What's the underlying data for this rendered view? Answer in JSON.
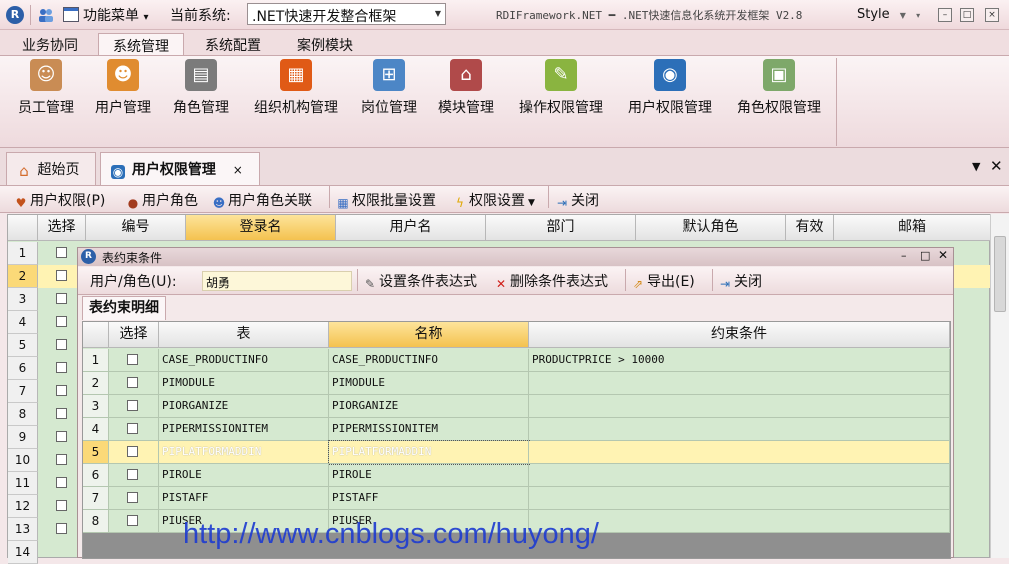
{
  "titlebar": {
    "menu_label": "功能菜单",
    "menu_caret": "▾",
    "system_label": "当前系统:",
    "system_value": ".NET快速开发整合框架",
    "app_title": "RDIFramework.NET ━ .NET快速信息化系统开发框架 V2.8",
    "style_label": "Style"
  },
  "ribbon_tabs": [
    "业务协同",
    "系统管理",
    "系统配置",
    "案例模块"
  ],
  "ribbon_buttons": [
    "员工管理",
    "用户管理",
    "角色管理",
    "组织机构管理",
    "岗位管理",
    "模块管理",
    "操作权限管理",
    "用户权限管理",
    "角色权限管理"
  ],
  "doc_tabs": {
    "home": "超始页",
    "current": "用户权限管理",
    "close": "×"
  },
  "toolbar": {
    "user_perm": "用户权限(P)",
    "user_role": "用户角色",
    "user_role_link": "用户角色关联",
    "batch_perm": "权限批量设置",
    "perm_setting": "权限设置",
    "close": "关闭"
  },
  "grid": {
    "headers": [
      "选择",
      "编号",
      "登录名",
      "用户名",
      "部门",
      "默认角色",
      "有效",
      "邮箱"
    ],
    "row_numbers": [
      "1",
      "2",
      "3",
      "4",
      "5",
      "6",
      "7",
      "8",
      "9",
      "10",
      "11",
      "12",
      "13",
      "14"
    ]
  },
  "dialog": {
    "title": "表约束条件",
    "user_role_label": "用户/角色(U):",
    "user_role_value": "胡勇",
    "set_expr": "设置条件表达式",
    "delete_expr": "删除条件表达式",
    "export": "导出(E)",
    "close": "关闭",
    "subtab": "表约束明细",
    "headers": [
      "选择",
      "表",
      "名称",
      "约束条件"
    ],
    "rows": [
      {
        "num": "1",
        "table": "CASE_PRODUCTINFO",
        "name": "CASE_PRODUCTINFO",
        "cond": "PRODUCTPRICE > 10000"
      },
      {
        "num": "2",
        "table": "PIMODULE",
        "name": "PIMODULE",
        "cond": ""
      },
      {
        "num": "3",
        "table": "PIORGANIZE",
        "name": "PIORGANIZE",
        "cond": ""
      },
      {
        "num": "4",
        "table": "PIPERMISSIONITEM",
        "name": "PIPERMISSIONITEM",
        "cond": ""
      },
      {
        "num": "5",
        "table": "PIPLATFORMADDIN",
        "name": "PIPLATFORMADDIN",
        "cond": ""
      },
      {
        "num": "6",
        "table": "PIROLE",
        "name": "PIROLE",
        "cond": ""
      },
      {
        "num": "7",
        "table": "PISTAFF",
        "name": "PISTAFF",
        "cond": ""
      },
      {
        "num": "8",
        "table": "PIUSER",
        "name": "PIUSER",
        "cond": ""
      }
    ]
  },
  "watermark": "http://www.cnblogs.com/huyong/",
  "colors": {
    "grid_bg": "#d5e9d0",
    "sorted_header": "#f4c24f",
    "selected_row": "#fff3b3",
    "watermark": "#1d3bd1"
  }
}
